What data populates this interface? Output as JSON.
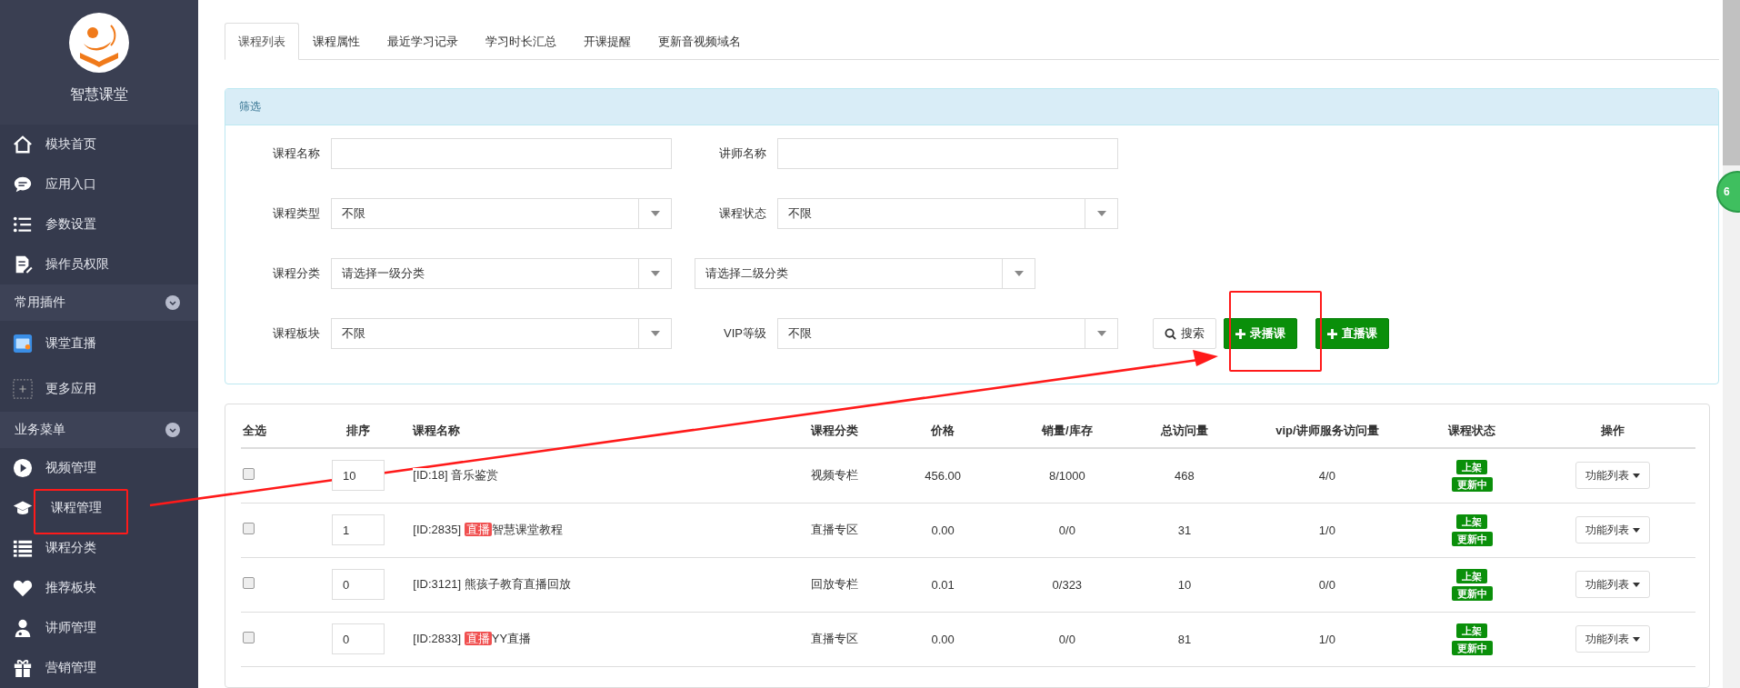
{
  "sidebar": {
    "brand": "智慧课堂",
    "groups": [
      {
        "items": [
          "模块首页",
          "应用入口",
          "参数设置",
          "操作员权限"
        ]
      },
      {
        "title": "常用插件",
        "expanded": true,
        "items": [
          "课堂直播",
          "更多应用"
        ]
      },
      {
        "title": "业务菜单",
        "expanded": true,
        "items": [
          "视频管理",
          "课程管理",
          "课程分类",
          "推荐板块",
          "讲师管理",
          "营销管理"
        ]
      }
    ]
  },
  "tabs": [
    {
      "label": "课程列表",
      "selected": true
    },
    {
      "label": "课程属性",
      "selected": false
    },
    {
      "label": "最近学习记录",
      "selected": false
    },
    {
      "label": "学习时长汇总",
      "selected": false
    },
    {
      "label": "开课提醒",
      "selected": false
    },
    {
      "label": "更新音视频域名",
      "selected": false
    }
  ],
  "filter": {
    "title": "筛选",
    "rows": [
      [
        {
          "kind": "input",
          "label": "课程名称"
        },
        {
          "kind": "input",
          "label": "讲师名称"
        }
      ],
      [
        {
          "kind": "select",
          "label": "课程类型",
          "value": "不限"
        },
        {
          "kind": "select",
          "label": "课程状态",
          "value": "不限"
        }
      ],
      [
        {
          "kind": "select",
          "label": "课程分类",
          "value": "请选择一级分类"
        },
        {
          "kind": "select",
          "value": "请选择二级分类"
        }
      ],
      [
        {
          "kind": "select",
          "label": "课程板块",
          "value": "不限"
        },
        {
          "kind": "select",
          "label": "VIP等级",
          "value": "不限"
        }
      ]
    ],
    "buttons": [
      {
        "kind": "search",
        "label": "搜索"
      },
      {
        "kind": "add",
        "label": "录播课"
      },
      {
        "kind": "add",
        "label": "直播课"
      }
    ]
  },
  "table": {
    "columns": [
      "全选",
      "排序",
      "课程名称",
      "课程分类",
      "价格",
      "销量/库存",
      "总访问量",
      "vip/讲师服务访问量",
      "课程状态",
      "操作"
    ],
    "rows": [
      {
        "checked": false,
        "order": "10",
        "id": "[ID:18]",
        "title": "音乐鉴赏",
        "category": "视频专栏",
        "price": "456.00",
        "sales": "8/1000",
        "visits": "468",
        "vip_visits": "4/0",
        "status": [
          "上架",
          "更新中"
        ],
        "action": "功能列表"
      },
      {
        "checked": false,
        "order": "1",
        "id": "[ID:2835]",
        "tag": "直播",
        "title": "智慧课堂教程",
        "category": "直播专区",
        "price": "0.00",
        "sales": "0/0",
        "visits": "31",
        "vip_visits": "1/0",
        "status": [
          "上架",
          "更新中"
        ],
        "action": "功能列表"
      },
      {
        "checked": false,
        "order": "0",
        "id": "[ID:3121]",
        "title": "熊孩子教育直播回放",
        "category": "回放专栏",
        "price": "0.01",
        "sales": "0/323",
        "visits": "10",
        "vip_visits": "0/0",
        "status": [
          "上架",
          "更新中"
        ],
        "action": "功能列表"
      },
      {
        "checked": false,
        "order": "0",
        "id": "[ID:2833]",
        "tag": "直播",
        "title": "YY直播",
        "category": "直播专区",
        "price": "0.00",
        "sales": "0/0",
        "visits": "81",
        "vip_visits": "1/0",
        "status": [
          "上架",
          "更新中"
        ],
        "action": "功能列表"
      }
    ]
  },
  "floating_widget": {
    "label": "6"
  }
}
